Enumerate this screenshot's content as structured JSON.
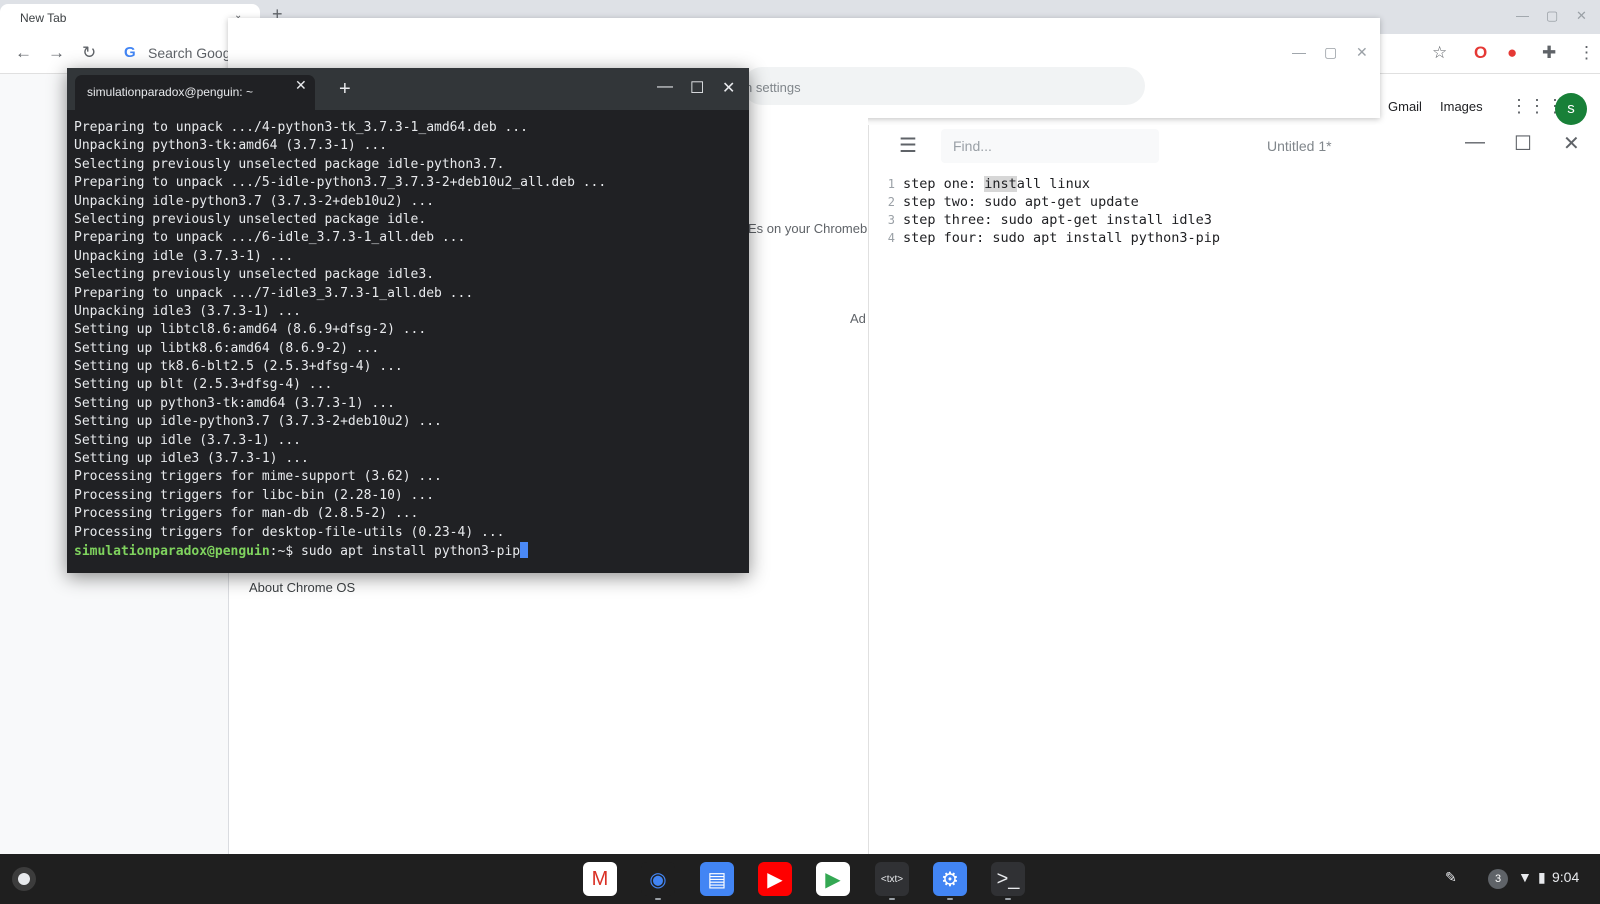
{
  "browser": {
    "tab_title": "New Tab",
    "newtab_plus": "+",
    "omnibox_text": "Search Goog",
    "gmail_label": "Gmail",
    "images_label": "Images",
    "avatar_letter": "s"
  },
  "settings": {
    "search_text": "n settings",
    "partial_text": "Es on your Chromeb",
    "ad_text": "Ad",
    "about_label": "About Chrome OS"
  },
  "terminal": {
    "tab_title": "simulationparadox@penguin: ~",
    "new_tab_plus": "+",
    "lines": [
      "Preparing to unpack .../4-python3-tk_3.7.3-1_amd64.deb ...",
      "Unpacking python3-tk:amd64 (3.7.3-1) ...",
      "Selecting previously unselected package idle-python3.7.",
      "Preparing to unpack .../5-idle-python3.7_3.7.3-2+deb10u2_all.deb ...",
      "Unpacking idle-python3.7 (3.7.3-2+deb10u2) ...",
      "Selecting previously unselected package idle.",
      "Preparing to unpack .../6-idle_3.7.3-1_all.deb ...",
      "Unpacking idle (3.7.3-1) ...",
      "Selecting previously unselected package idle3.",
      "Preparing to unpack .../7-idle3_3.7.3-1_all.deb ...",
      "Unpacking idle3 (3.7.3-1) ...",
      "Setting up libtcl8.6:amd64 (8.6.9+dfsg-2) ...",
      "Setting up libtk8.6:amd64 (8.6.9-2) ...",
      "Setting up tk8.6-blt2.5 (2.5.3+dfsg-4) ...",
      "Setting up blt (2.5.3+dfsg-4) ...",
      "Setting up python3-tk:amd64 (3.7.3-1) ...",
      "Setting up idle-python3.7 (3.7.3-2+deb10u2) ...",
      "Setting up idle (3.7.3-1) ...",
      "Setting up idle3 (3.7.3-1) ...",
      "Processing triggers for mime-support (3.62) ...",
      "Processing triggers for libc-bin (2.28-10) ...",
      "Processing triggers for man-db (2.8.5-2) ...",
      "Processing triggers for desktop-file-utils (0.23-4) ..."
    ],
    "prompt_user": "simulationparadox@penguin",
    "prompt_path": ":~$ ",
    "command": "sudo apt install python3-pip"
  },
  "editor": {
    "find_placeholder": "Find...",
    "title": "Untitled 1*",
    "line_numbers": [
      "1",
      "2",
      "3",
      "4"
    ],
    "line1_pre": "step one: ",
    "line1_hl": "inst",
    "line1_post": "all linux",
    "lines_rest": [
      "step two: sudo apt-get update",
      "step three: sudo apt-get install idle3",
      "step four: sudo apt install python3-pip"
    ]
  },
  "shelf": {
    "apps": [
      {
        "name": "gmail",
        "glyph": "M",
        "color": "#d93025",
        "bg": "#ffffff"
      },
      {
        "name": "chrome",
        "glyph": "◉",
        "color": "#4285f4",
        "bg": "#1f1f1f"
      },
      {
        "name": "docs",
        "glyph": "▤",
        "color": "#ffffff",
        "bg": "#4285f4"
      },
      {
        "name": "youtube",
        "glyph": "▶",
        "color": "#ffffff",
        "bg": "#ff0000"
      },
      {
        "name": "play-store",
        "glyph": "▶",
        "color": "#34a853",
        "bg": "#ffffff"
      },
      {
        "name": "text",
        "glyph": "<txt>",
        "color": "#e8eaed",
        "bg": "#303134"
      },
      {
        "name": "settings",
        "glyph": "⚙",
        "color": "#ffffff",
        "bg": "#4285f4"
      },
      {
        "name": "terminal",
        "glyph": ">_",
        "color": "#e8eaed",
        "bg": "#303134"
      }
    ],
    "badge_count": "3",
    "time": "9:04"
  }
}
